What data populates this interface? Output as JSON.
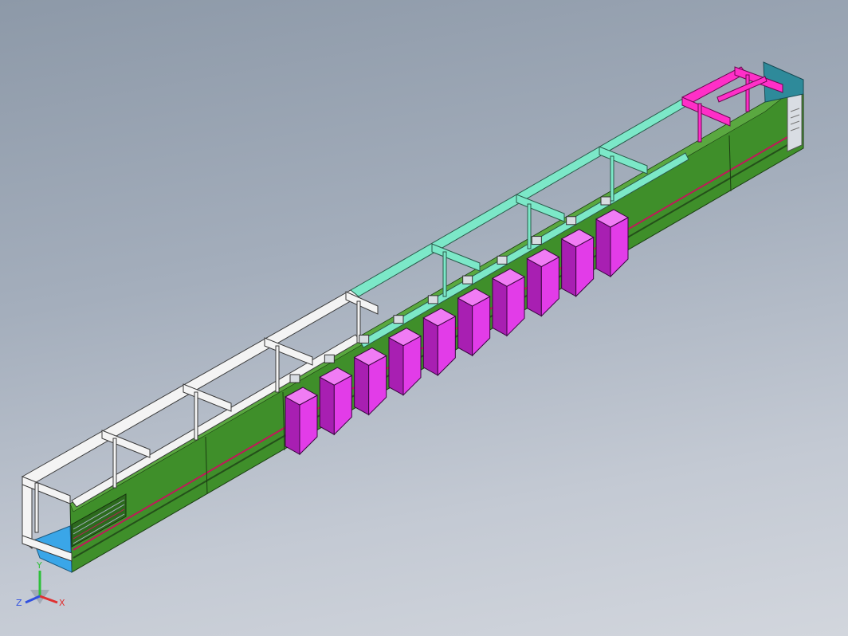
{
  "viewport": {
    "background_top": "#8d99a8",
    "background_bottom": "#d2d6dd"
  },
  "model": {
    "frame_white": "#f4f4f4",
    "frame_cyan": "#7ce8c8",
    "frame_magenta": "#ff2fc8",
    "panel_green": "#3f8f2a",
    "panel_green_dark": "#2c6a1d",
    "hopper_magenta": "#e23ce8",
    "hopper_magenta_dark": "#a81fb2",
    "end_cap_blue": "#3aa6e8",
    "end_cap_teal": "#2e8a9a",
    "hopper_count": 10
  },
  "triad": {
    "x_label": "X",
    "y_label": "Y",
    "z_label": "Z",
    "x_color": "#e03030",
    "y_color": "#2ec03a",
    "z_color": "#3050e0"
  }
}
